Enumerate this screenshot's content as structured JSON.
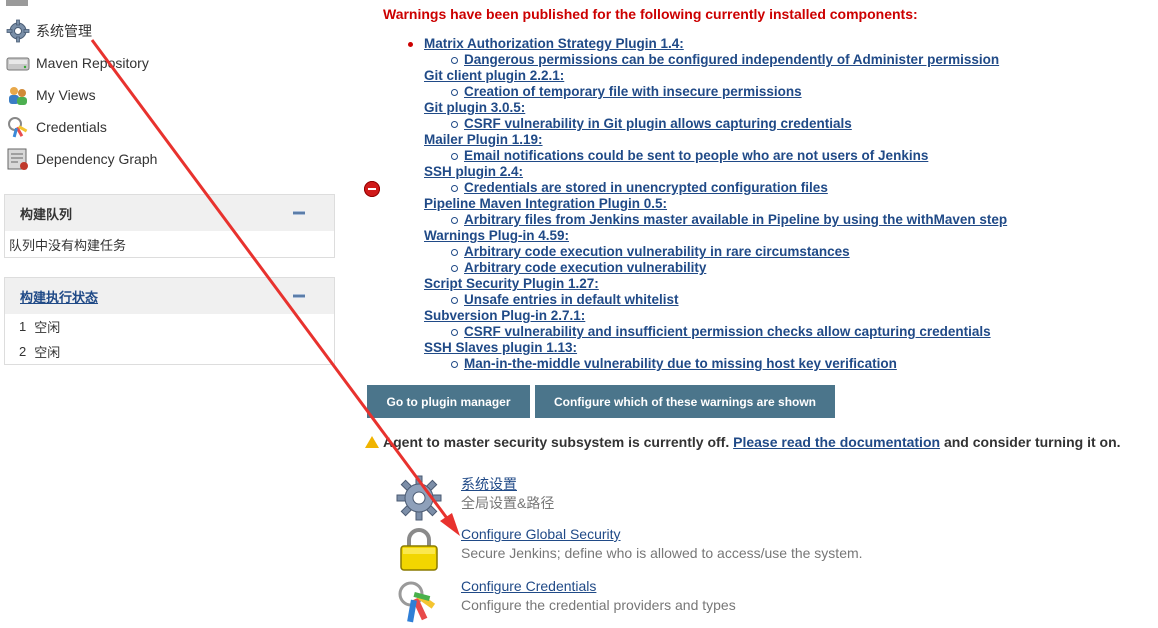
{
  "sidebar": {
    "items": [
      {
        "label": "系统管理",
        "icon": "gear-icon"
      },
      {
        "label": "Maven Repository",
        "icon": "repository-icon"
      },
      {
        "label": "My Views",
        "icon": "users-icon"
      },
      {
        "label": "Credentials",
        "icon": "keys-icon"
      },
      {
        "label": "Dependency Graph",
        "icon": "graph-icon"
      }
    ],
    "build_queue": {
      "title": "构建队列",
      "empty_text": "队列中没有构建任务"
    },
    "executors": {
      "title": "构建执行状态",
      "rows": [
        {
          "num": "1",
          "status": "空闲"
        },
        {
          "num": "2",
          "status": "空闲"
        }
      ]
    }
  },
  "main": {
    "warnings_title": "Warnings have been published for the following currently installed components:",
    "plugins": [
      {
        "name": "Matrix Authorization Strategy Plugin 1.4:",
        "warnings": [
          "Dangerous permissions can be configured independently of Administer permission"
        ]
      },
      {
        "name": "Git client plugin 2.2.1:",
        "warnings": [
          "Creation of temporary file with insecure permissions"
        ]
      },
      {
        "name": "Git plugin 3.0.5:",
        "warnings": [
          "CSRF vulnerability in Git plugin allows capturing credentials"
        ]
      },
      {
        "name": "Mailer Plugin 1.19:",
        "warnings": [
          "Email notifications could be sent to people who are not users of Jenkins"
        ]
      },
      {
        "name": "SSH plugin 2.4:",
        "warnings": [
          "Credentials are stored in unencrypted configuration files"
        ]
      },
      {
        "name": "Pipeline Maven Integration Plugin 0.5:",
        "warnings": [
          "Arbitrary files from Jenkins master available in Pipeline by using the withMaven step"
        ]
      },
      {
        "name": "Warnings Plug-in 4.59:",
        "warnings": [
          "Arbitrary code execution vulnerability in rare circumstances",
          "Arbitrary code execution vulnerability"
        ]
      },
      {
        "name": "Script Security Plugin 1.27:",
        "warnings": [
          "Unsafe entries in default whitelist"
        ]
      },
      {
        "name": "Subversion Plug-in 2.7.1:",
        "warnings": [
          "CSRF vulnerability and insufficient permission checks allow capturing credentials"
        ]
      },
      {
        "name": "SSH Slaves plugin 1.13:",
        "warnings": [
          "Man-in-the-middle vulnerability due to missing host key verification"
        ]
      }
    ],
    "buttons": {
      "plugin_manager": "Go to plugin manager",
      "configure_warnings": "Configure which of these warnings are shown"
    },
    "agent_notice": {
      "before": "Agent to master security subsystem is currently off. ",
      "link": "Please read the documentation",
      "after": " and consider turning it on."
    },
    "manage_items": [
      {
        "title": "系统设置",
        "desc": "全局设置&路径",
        "icon": "gear-icon"
      },
      {
        "title": "Configure Global Security",
        "desc": "Secure Jenkins; define who is allowed to access/use the system.",
        "icon": "lock-icon"
      },
      {
        "title": "Configure Credentials",
        "desc": "Configure the credential providers and types",
        "icon": "keys-icon"
      }
    ]
  },
  "colors": {
    "accent_link": "#204a87",
    "warning_red": "#cc0000",
    "button_bg": "#4b758b",
    "annotation_arrow": "#e8322e"
  }
}
